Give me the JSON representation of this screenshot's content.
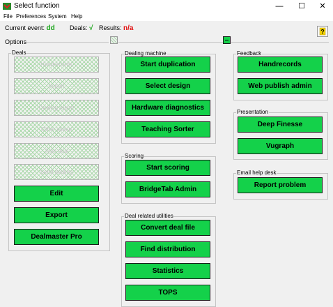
{
  "window": {
    "title": "Select function",
    "accent": "#16d04c"
  },
  "menu": {
    "items": [
      "File",
      "Preferences",
      "System",
      "Help"
    ]
  },
  "status": {
    "current_event_label": "Current event:",
    "current_event_value": "dd",
    "deals_label": "Deals:",
    "deals_value": "√",
    "results_label": "Results:",
    "results_value": "n/a"
  },
  "options_label": "Options",
  "deals_group": {
    "label": "Deals",
    "disabled_buttons": [
      "Handrecords",
      "Import",
      "Dealing report",
      "Other stamp",
      "Type deal",
      "Send dealing"
    ],
    "buttons": [
      "Edit",
      "Export",
      "Dealmaster Pro"
    ]
  },
  "dealing_machine_group": {
    "label": "Dealing machine",
    "buttons": [
      "Start duplication",
      "Select design",
      "Hardware diagnostics",
      "Teaching Sorter"
    ]
  },
  "scoring_group": {
    "label": "Scoring",
    "buttons": [
      "Start scoring",
      "BridgeTab Admin"
    ]
  },
  "deal_utils_group": {
    "label": "Deal related utilities",
    "buttons": [
      "Convert deal file",
      "Find distribution",
      "Statistics",
      "TOPS"
    ]
  },
  "feedback_group": {
    "label": "Feedback",
    "buttons": [
      "Handrecords",
      "Web publish admin"
    ]
  },
  "presentation_group": {
    "label": "Presentation",
    "buttons": [
      "Deep Finesse",
      "Vugraph"
    ]
  },
  "email_group": {
    "label": "Email help desk",
    "buttons": [
      "Report problem"
    ]
  }
}
